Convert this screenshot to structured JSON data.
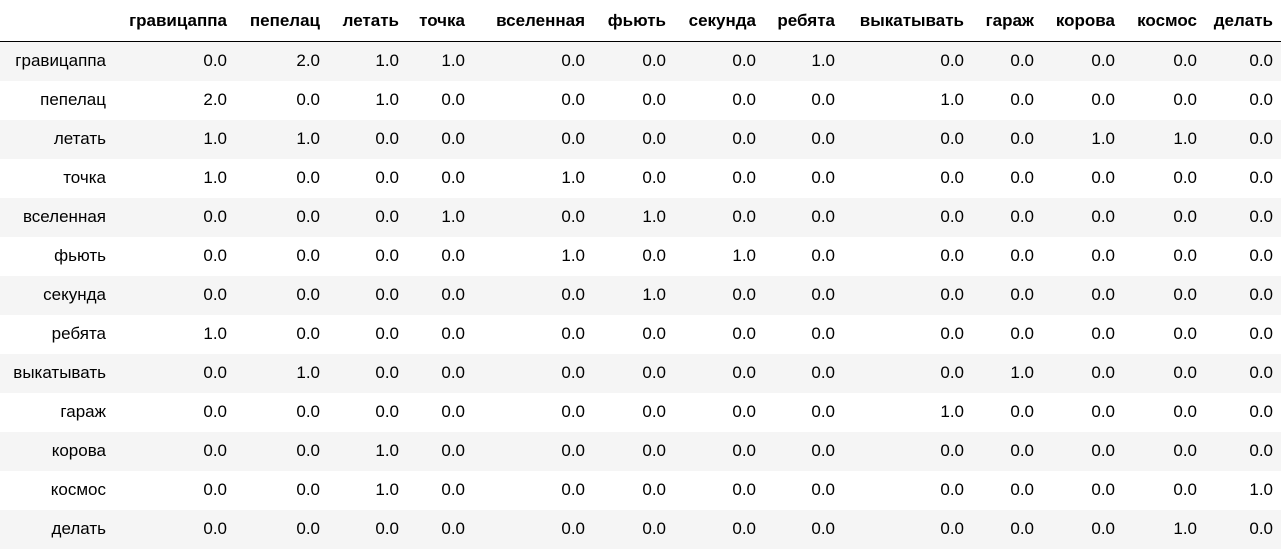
{
  "table": {
    "columns": [
      "гравицаппа",
      "пепелац",
      "летать",
      "точка",
      "вселенная",
      "фьють",
      "секунда",
      "ребята",
      "выкатывать",
      "гараж",
      "корова",
      "космос",
      "делать"
    ],
    "rows": [
      {
        "label": "гравицаппа",
        "values": [
          "0.0",
          "2.0",
          "1.0",
          "1.0",
          "0.0",
          "0.0",
          "0.0",
          "1.0",
          "0.0",
          "0.0",
          "0.0",
          "0.0",
          "0.0"
        ]
      },
      {
        "label": "пепелац",
        "values": [
          "2.0",
          "0.0",
          "1.0",
          "0.0",
          "0.0",
          "0.0",
          "0.0",
          "0.0",
          "1.0",
          "0.0",
          "0.0",
          "0.0",
          "0.0"
        ]
      },
      {
        "label": "летать",
        "values": [
          "1.0",
          "1.0",
          "0.0",
          "0.0",
          "0.0",
          "0.0",
          "0.0",
          "0.0",
          "0.0",
          "0.0",
          "1.0",
          "1.0",
          "0.0"
        ]
      },
      {
        "label": "точка",
        "values": [
          "1.0",
          "0.0",
          "0.0",
          "0.0",
          "1.0",
          "0.0",
          "0.0",
          "0.0",
          "0.0",
          "0.0",
          "0.0",
          "0.0",
          "0.0"
        ]
      },
      {
        "label": "вселенная",
        "values": [
          "0.0",
          "0.0",
          "0.0",
          "1.0",
          "0.0",
          "1.0",
          "0.0",
          "0.0",
          "0.0",
          "0.0",
          "0.0",
          "0.0",
          "0.0"
        ]
      },
      {
        "label": "фьють",
        "values": [
          "0.0",
          "0.0",
          "0.0",
          "0.0",
          "1.0",
          "0.0",
          "1.0",
          "0.0",
          "0.0",
          "0.0",
          "0.0",
          "0.0",
          "0.0"
        ]
      },
      {
        "label": "секунда",
        "values": [
          "0.0",
          "0.0",
          "0.0",
          "0.0",
          "0.0",
          "1.0",
          "0.0",
          "0.0",
          "0.0",
          "0.0",
          "0.0",
          "0.0",
          "0.0"
        ]
      },
      {
        "label": "ребята",
        "values": [
          "1.0",
          "0.0",
          "0.0",
          "0.0",
          "0.0",
          "0.0",
          "0.0",
          "0.0",
          "0.0",
          "0.0",
          "0.0",
          "0.0",
          "0.0"
        ]
      },
      {
        "label": "выкатывать",
        "values": [
          "0.0",
          "1.0",
          "0.0",
          "0.0",
          "0.0",
          "0.0",
          "0.0",
          "0.0",
          "0.0",
          "1.0",
          "0.0",
          "0.0",
          "0.0"
        ]
      },
      {
        "label": "гараж",
        "values": [
          "0.0",
          "0.0",
          "0.0",
          "0.0",
          "0.0",
          "0.0",
          "0.0",
          "0.0",
          "1.0",
          "0.0",
          "0.0",
          "0.0",
          "0.0"
        ]
      },
      {
        "label": "корова",
        "values": [
          "0.0",
          "0.0",
          "1.0",
          "0.0",
          "0.0",
          "0.0",
          "0.0",
          "0.0",
          "0.0",
          "0.0",
          "0.0",
          "0.0",
          "0.0"
        ]
      },
      {
        "label": "космос",
        "values": [
          "0.0",
          "0.0",
          "1.0",
          "0.0",
          "0.0",
          "0.0",
          "0.0",
          "0.0",
          "0.0",
          "0.0",
          "0.0",
          "0.0",
          "1.0"
        ]
      },
      {
        "label": "делать",
        "values": [
          "0.0",
          "0.0",
          "0.0",
          "0.0",
          "0.0",
          "0.0",
          "0.0",
          "0.0",
          "0.0",
          "0.0",
          "0.0",
          "1.0",
          "0.0"
        ]
      }
    ]
  },
  "colors": {
    "stripe_row": "#f5f5f5",
    "header_rule": "#000000",
    "text": "#000000"
  }
}
